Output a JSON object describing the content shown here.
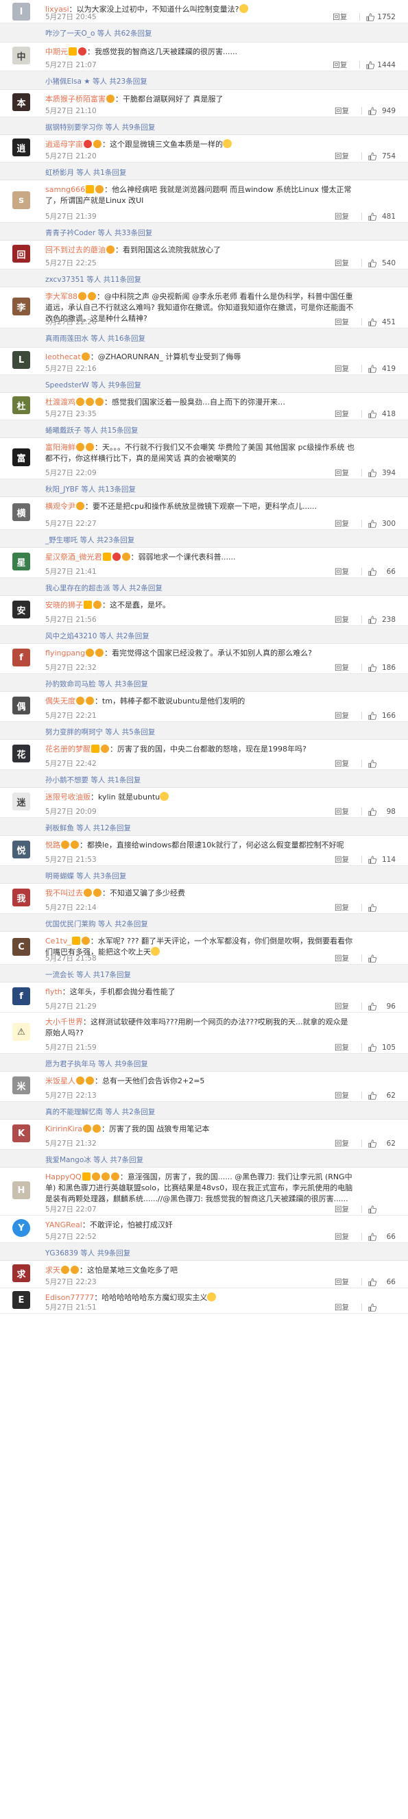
{
  "labels": {
    "reply": "回复"
  },
  "rows": [
    {
      "t": "comment",
      "h": 34,
      "name": "lixyasi",
      "text": "以为大家没上过初中，不知道什么叫控制变量法?",
      "time": "5月27日 20:45",
      "likes": "1752",
      "av": "#b0b6bf",
      "avt": "l",
      "emoji": true
    },
    {
      "t": "sub",
      "h": 28,
      "text": "咋沙了一天O_o 等人 共62条回复"
    },
    {
      "t": "comment",
      "h": 42,
      "name": "中期元",
      "text": "我感觉我的智商这几天被蹂躏的很厉害......",
      "time": "5月27日 21:07",
      "likes": "1444",
      "av": "#d7d7cf",
      "avt": "中",
      "badges": "vr"
    },
    {
      "t": "sub",
      "h": 27,
      "text": "小猪佩Elsa ★ 等人 共23条回复"
    },
    {
      "t": "comment",
      "h": 40,
      "name": "本质猴子桥陌富害",
      "text": "干脆都台湖联网好了 真是服了",
      "time": "5月27日 21:10",
      "likes": "949",
      "av": "#3b2b28",
      "avt": "本",
      "badges": "o"
    },
    {
      "t": "sub",
      "h": 26,
      "text": "据钢特别要学习你 等人 共9条回复"
    },
    {
      "t": "comment",
      "h": 40,
      "name": "逍遥母字亩",
      "text": "这个跟显微镜三文鱼本质是一样的",
      "time": "5月27日 21:20",
      "likes": "754",
      "av": "#222",
      "avt": "逍",
      "badges": "ro",
      "emoji": true
    },
    {
      "t": "sub",
      "h": 26,
      "text": "虹桥影月 等人 共1条回复"
    },
    {
      "t": "comment",
      "h": 62,
      "name": "samng666",
      "text": "他么神经病吧 我就是浏览器问题啊 而且window 系统比Linux 慢太正常了，所谓国产就是Linux 改UI",
      "time": "5月27日 21:39",
      "likes": "481",
      "av": "#c9a985",
      "avt": "s",
      "badges": "vo"
    },
    {
      "t": "sub",
      "h": 26,
      "text": "青青子衿Coder 等人 共33条回复"
    },
    {
      "t": "comment",
      "h": 42,
      "name": "回不到过去的蘑油",
      "text": "看到阳国这么流院我就放心了",
      "time": "5月27日 22:25",
      "likes": "540",
      "av": "#9c2424",
      "avt": "回",
      "badges": "o"
    },
    {
      "t": "sub",
      "h": 26,
      "text": "zxcv37351 等人 共11条回复"
    },
    {
      "t": "comment",
      "h": 60,
      "name": "李大军88",
      "text": "@中科院之声 @央视新闻 @李永乐老师 看看什么是伪科学，科普中国任重道远，承认自己不行就这么难吗? 我知道你在撒谎。你知道我知道你在撒谎，可是你还能面不改色的撒谎，这是种什么精神?",
      "time": "5月27日 22:26",
      "likes": "451",
      "av": "#8a5a3c",
      "avt": "李",
      "badges": "oo"
    },
    {
      "t": "sub",
      "h": 28,
      "text": "真雨雨莲田水 等人 共16条回复"
    },
    {
      "t": "comment",
      "h": 40,
      "name": "leothecat",
      "text": "@ZHAORUNRAN_ 计算机专业受到了侮辱",
      "time": "5月27日 22:16",
      "likes": "419",
      "av": "#3d4a3a",
      "avt": "L",
      "badges": "o"
    },
    {
      "t": "sub",
      "h": 26,
      "text": "SpeedsterW 等人 共9条回复"
    },
    {
      "t": "comment",
      "h": 40,
      "name": "杜渡渡鸡",
      "text": "感觉我们国家泛着一股臭劲…自上而下的弥漫开来…",
      "time": "5月27日 23:35",
      "likes": "418",
      "av": "#6b7c3a",
      "avt": "杜",
      "badges": "ooo"
    },
    {
      "t": "sub",
      "h": 26,
      "text": "蜷曦戴跃子 等人 共15条回复"
    },
    {
      "t": "comment",
      "h": 60,
      "name": "富阳海鲜",
      "text": "天。。。不行就不行我们又不会嘲笑 华费险了美国 其他国家 pc级操作系统 也都不行，你这样横行比下，真的是闹笑话 真的会被嘲笑的",
      "time": "5月27日 22:09",
      "likes": "394",
      "av": "#1c1c1c",
      "avt": "富",
      "badges": "oo"
    },
    {
      "t": "sub",
      "h": 26,
      "text": "秋阳_JYBF 等人 共13条回复"
    },
    {
      "t": "comment",
      "h": 48,
      "name": "横观令尹",
      "text": "要不还是把cpu和操作系统放显微镜下观察一下吧，更科学点儿......",
      "time": "5月27日 22:27",
      "likes": "300",
      "av": "#6a6a6a",
      "avt": "横",
      "badges": "o"
    },
    {
      "t": "sub",
      "h": 26,
      "text": "_野生哪吒 等人 共23条回复"
    },
    {
      "t": "comment",
      "h": 44,
      "name": "星汉祭酒_微光君",
      "text": "弱弱地求一个课代表科普......",
      "time": "5月27日 21:41",
      "likes": "66",
      "av": "#3a7e4b",
      "avt": "星",
      "badges": "vro"
    },
    {
      "t": "sub",
      "h": 26,
      "text": "我心里存在的超击派 等人 共2条回复"
    },
    {
      "t": "comment",
      "h": 44,
      "name": "安晓的狮子",
      "text": "这不是蠢，是坏。",
      "time": "5月27日 21:56",
      "likes": "238",
      "av": "#2b2b2b",
      "avt": "安",
      "badges": "vo"
    },
    {
      "t": "sub",
      "h": 26,
      "text": "风中之焰43210 等人 共2条回复"
    },
    {
      "t": "comment",
      "h": 44,
      "name": "flyingpang",
      "text": "看完觉得这个国家已经没救了。承认不如别人真的那么难么?",
      "time": "5月27日 22:32",
      "likes": "186",
      "av": "#b84a3b",
      "avt": "f",
      "badges": "oo"
    },
    {
      "t": "sub",
      "h": 26,
      "text": "孙豹致命司马脸 等人 共3条回复"
    },
    {
      "t": "comment",
      "h": 44,
      "name": "偶失无度",
      "text": "tm，韩棒子都不敢说ubuntu是他们发明的",
      "time": "5月27日 22:21",
      "likes": "166",
      "av": "#505050",
      "avt": "偶",
      "badges": "oo"
    },
    {
      "t": "sub",
      "h": 26,
      "text": "努力变胖的啊珂宁 等人 共5条回复"
    },
    {
      "t": "comment",
      "h": 44,
      "name": "花名册的梦醒",
      "text": "厉害了我的国，中央二台都敢的怒啥，现在是1998年吗?",
      "time": "5月27日 22:42",
      "likes": "",
      "av": "#2d3136",
      "avt": "花",
      "badges": "vo"
    },
    {
      "t": "sub",
      "h": 26,
      "text": "孙小鹅不想要 等人 共1条回复"
    },
    {
      "t": "comment",
      "h": 44,
      "name": "迷限号收油贩",
      "text": "kylin 就是ubuntu",
      "time": "5月27日 20:09",
      "likes": "98",
      "av": "#e8e8e8",
      "avt": "迷",
      "emoji": true
    },
    {
      "t": "sub",
      "h": 26,
      "text": "剥板鲜鱼 等人 共12条回复"
    },
    {
      "t": "comment",
      "h": 44,
      "name": "悦路",
      "text": "都换le，直接给windows都台限速10k就行了，何必这么假变量都控制不好呢",
      "time": "5月27日 21:53",
      "likes": "114",
      "av": "#4a6077",
      "avt": "悦",
      "badges": "oo"
    },
    {
      "t": "sub",
      "h": 26,
      "text": "明哥蝴蝶 等人 共3条回复"
    },
    {
      "t": "comment",
      "h": 44,
      "name": "我不叫过去",
      "text": "不知道又骗了多少经费",
      "time": "5月27日 22:14",
      "likes": "",
      "av": "#b33a3a",
      "avt": "我",
      "badges": "oo"
    },
    {
      "t": "sub",
      "h": 26,
      "text": "优国优民门莱购 等人 共2条回复"
    },
    {
      "t": "comment",
      "h": 48,
      "name": "Ce1tv_",
      "text": "水军呢? ??? 翻了半天评论，一个水军都没有，你们倒是吹啊，我倒要看看你们嘴巴有多强，能把这个吹上天",
      "time": "5月27日 21:58",
      "likes": "",
      "av": "#6b4a35",
      "avt": "C",
      "badges": "vo",
      "emoji": true
    },
    {
      "t": "sub",
      "h": 26,
      "text": "一流会长 等人 共17条回复"
    },
    {
      "t": "comment",
      "h": 44,
      "name": "flyth",
      "text": "这年头，手机都会抛分看性能了",
      "time": "5月27日 21:29",
      "likes": "96",
      "av": "#2a4a7e",
      "avt": "f"
    },
    {
      "t": "comment",
      "h": 60,
      "name": "大小千世界",
      "text": "这样测试软硬件效率吗???用刷一个网页的办法???哎刷我的天...就拿的观众是原始人吗??",
      "time": "5月27日 21:59",
      "likes": "105",
      "av": "#fff7d1",
      "avt": "⚠"
    },
    {
      "t": "sub",
      "h": 26,
      "text": "愿为君子执年马 等人 共9条回复"
    },
    {
      "t": "comment",
      "h": 44,
      "name": "米饭星人",
      "text": "总有一天他们会告诉你2+2=5",
      "time": "5月27日 22:13",
      "likes": "62",
      "av": "#909090",
      "avt": "米",
      "badges": "oo"
    },
    {
      "t": "sub",
      "h": 26,
      "text": "真的不能理解忆南 等人 共2条回复"
    },
    {
      "t": "comment",
      "h": 44,
      "name": "KiririnKira",
      "text": "厉害了我的国 战狼专用笔记本",
      "time": "5月27日 21:32",
      "likes": "62",
      "av": "#b04b4b",
      "avt": "K",
      "badges": "oo"
    },
    {
      "t": "sub",
      "h": 26,
      "text": "我爱Mango冰 等人 共7条回复"
    },
    {
      "t": "comment",
      "h": 70,
      "name": "HappyQQ",
      "text": "意淫强国，厉害了，我的国...... @黑色骤刀: 我们让李元凯 (RNG中单) 和黑色骤刀进行英雄联盟solo，比赛结果是48vs0，现在我正式宣布，李元凯使用的电脑是装有两颗处理器，麒麟系统......//@黑色骤刀: 我感觉我的智商这几天被蹂躏的很厉害......",
      "time": "5月27日 22:07",
      "likes": "",
      "av": "#c9bfae",
      "avt": "H",
      "badges": "vooo"
    },
    {
      "t": "comment",
      "h": 40,
      "name": "YANGReal",
      "text": "不敢评论，怕被打成汉奸",
      "time": "5月27日 22:52",
      "likes": "66",
      "av": "#2e8fe6",
      "avt": "Y",
      "round": true
    },
    {
      "t": "sub",
      "h": 26,
      "text": "YG36839 等人 共9条回复"
    },
    {
      "t": "comment",
      "h": 40,
      "name": "求天",
      "text": "这怕是某地三文鱼吃多了吧",
      "time": "5月27日 22:23",
      "likes": "66",
      "av": "#a03030",
      "avt": "求",
      "badges": "oo"
    },
    {
      "t": "comment",
      "h": 37,
      "name": "Edison77777",
      "text": "哈哈哈哈哈哈东方魔幻现实主义",
      "time": "5月27日 21:51",
      "likes": "",
      "av": "#2b2b2b",
      "avt": "E",
      "emoji": true
    }
  ]
}
